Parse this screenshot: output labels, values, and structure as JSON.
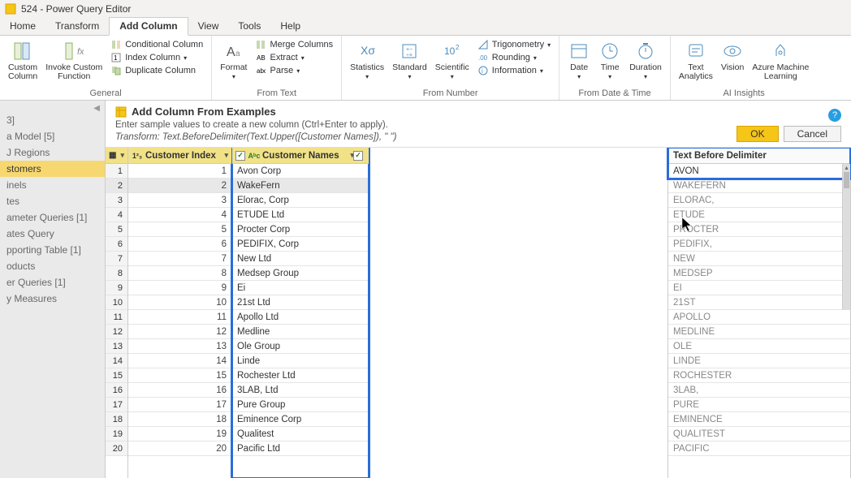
{
  "title": "524 - Power Query Editor",
  "menu": [
    "Home",
    "Transform",
    "Add Column",
    "View",
    "Tools",
    "Help"
  ],
  "menu_active": 2,
  "ribbon": {
    "general": {
      "label": "General",
      "custom_col": "Custom\nColumn",
      "invoke": "Invoke Custom\nFunction",
      "conditional": "Conditional Column",
      "index": "Index Column",
      "duplicate": "Duplicate Column"
    },
    "from_text": {
      "label": "From Text",
      "format": "Format",
      "merge": "Merge Columns",
      "extract": "Extract",
      "parse": "Parse"
    },
    "from_number": {
      "label": "From Number",
      "stats": "Statistics",
      "standard": "Standard",
      "scientific": "Scientific",
      "trig": "Trigonometry",
      "rounding": "Rounding",
      "info": "Information"
    },
    "from_date": {
      "label": "From Date & Time",
      "date": "Date",
      "time": "Time",
      "duration": "Duration"
    },
    "ai": {
      "label": "AI Insights",
      "text": "Text\nAnalytics",
      "vision": "Vision",
      "azure": "Azure Machine\nLearning"
    }
  },
  "sidebar": {
    "items": [
      {
        "label": "3]",
        "sel": false
      },
      {
        "label": "a Model [5]",
        "sel": false
      },
      {
        "label": "J Regions",
        "sel": false
      },
      {
        "label": "stomers",
        "sel": true
      },
      {
        "label": "inels",
        "sel": false
      },
      {
        "label": "tes",
        "sel": false
      },
      {
        "label": "ameter Queries [1]",
        "sel": false
      },
      {
        "label": "ates Query",
        "sel": false
      },
      {
        "label": "pporting Table [1]",
        "sel": false
      },
      {
        "label": "oducts",
        "sel": false
      },
      {
        "label": "er Queries [1]",
        "sel": false
      },
      {
        "label": "y Measures",
        "sel": false
      }
    ]
  },
  "panel": {
    "title": "Add Column From Examples",
    "sub": "Enter sample values to create a new column (Ctrl+Enter to apply).",
    "tf": "Transform: Text.BeforeDelimiter(Text.Upper([Customer Names]), \" \")",
    "ok": "OK",
    "cancel": "Cancel"
  },
  "columns": {
    "idx_header": "Customer Index",
    "names_header": "Customer Names",
    "result_header": "Text Before Delimiter"
  },
  "rows": [
    {
      "n": 1,
      "idx": 1,
      "name": "Avon Corp",
      "res": "AVON"
    },
    {
      "n": 2,
      "idx": 2,
      "name": "WakeFern",
      "res": "WAKEFERN"
    },
    {
      "n": 3,
      "idx": 3,
      "name": "Elorac, Corp",
      "res": "ELORAC,"
    },
    {
      "n": 4,
      "idx": 4,
      "name": "ETUDE Ltd",
      "res": "ETUDE"
    },
    {
      "n": 5,
      "idx": 5,
      "name": "Procter Corp",
      "res": "PROCTER"
    },
    {
      "n": 6,
      "idx": 6,
      "name": "PEDIFIX, Corp",
      "res": "PEDIFIX,"
    },
    {
      "n": 7,
      "idx": 7,
      "name": "New Ltd",
      "res": "NEW"
    },
    {
      "n": 8,
      "idx": 8,
      "name": "Medsep Group",
      "res": "MEDSEP"
    },
    {
      "n": 9,
      "idx": 9,
      "name": "Ei",
      "res": "EI"
    },
    {
      "n": 10,
      "idx": 10,
      "name": "21st Ltd",
      "res": "21ST"
    },
    {
      "n": 11,
      "idx": 11,
      "name": "Apollo Ltd",
      "res": "APOLLO"
    },
    {
      "n": 12,
      "idx": 12,
      "name": "Medline",
      "res": "MEDLINE"
    },
    {
      "n": 13,
      "idx": 13,
      "name": "Ole Group",
      "res": "OLE"
    },
    {
      "n": 14,
      "idx": 14,
      "name": "Linde",
      "res": "LINDE"
    },
    {
      "n": 15,
      "idx": 15,
      "name": "Rochester Ltd",
      "res": "ROCHESTER"
    },
    {
      "n": 16,
      "idx": 16,
      "name": "3LAB, Ltd",
      "res": "3LAB,"
    },
    {
      "n": 17,
      "idx": 17,
      "name": "Pure Group",
      "res": "PURE"
    },
    {
      "n": 18,
      "idx": 18,
      "name": "Eminence Corp",
      "res": "EMINENCE"
    },
    {
      "n": 19,
      "idx": 19,
      "name": "Qualitest",
      "res": "QUALITEST"
    },
    {
      "n": 20,
      "idx": 20,
      "name": "Pacific Ltd",
      "res": "PACIFIC"
    }
  ]
}
